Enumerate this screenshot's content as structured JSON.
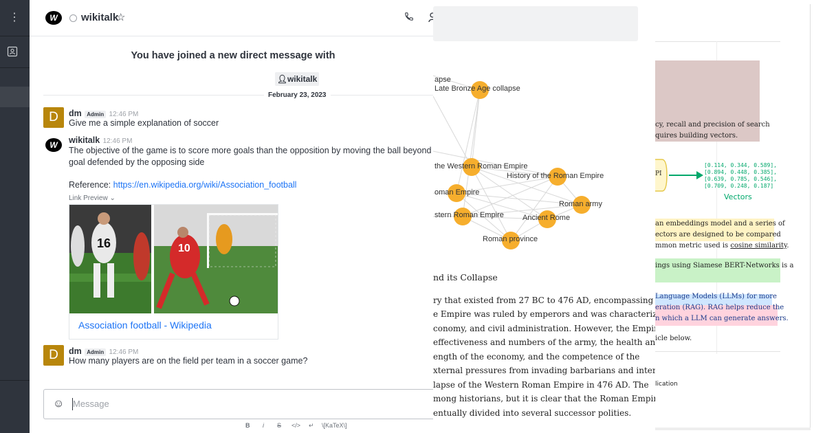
{
  "room": {
    "name": "wikitalk",
    "avatar_letter": "W"
  },
  "intro": {
    "joined_text": "You have joined a new direct message with",
    "mention": "wikitalk",
    "date": "February 23, 2023"
  },
  "messages": [
    {
      "avatar": "D",
      "user": "dm",
      "badge": "Admin",
      "time": "12:46 PM",
      "text": "Give me a simple explanation of soccer"
    },
    {
      "avatar": "W",
      "user": "wikitalk",
      "time": "12:46 PM",
      "text_line1": "The objective of the game is to score more goals than the opposition by moving the ball beyond the goa",
      "text_line2": "goal defended by the opposing side",
      "reference_label": "Reference:",
      "reference_url": "https://en.wikipedia.org/wiki/Association_football",
      "link_preview_label": "Link Preview",
      "preview_title": "Association football - Wikipedia"
    },
    {
      "avatar": "D",
      "user": "dm",
      "badge": "Admin",
      "time": "12:46 PM",
      "text": "How many players are on the field per team in a soccer game?"
    }
  ],
  "composer": {
    "placeholder": "Message",
    "toolbar": [
      "B",
      "i",
      "S",
      "</>",
      "↵",
      "\\[KaTeX\\]"
    ]
  },
  "graph": {
    "labels": {
      "l_apse": "apse",
      "bronze": "Late Bronze Age collapse",
      "western": "the Western Roman Empire",
      "history": "History of the Roman Empire",
      "roman_empire": "oman Empire",
      "roman_army": "Roman army",
      "stern": "stern Roman Empire",
      "ancient": "Ancient Rome",
      "province": "Roman province"
    },
    "heading": "nd its Collapse",
    "paragraph": [
      "ry that existed from 27 BC to 476 AD, encompassing",
      "e Empire was ruled by emperors and was characterized",
      "conomy, and civil administration. However, the Empire",
      "effectiveness and numbers of the army, the health and",
      "ength of the economy, and the competence of the",
      "xternal pressures from invading barbarians and internal",
      "lapse of the Western Roman Empire in 476 AD. The",
      "mong historians, but it is clear that the Roman Empire",
      "entually divided into several successor polities."
    ],
    "node_color": "#f6ae2d"
  },
  "document": {
    "lines_top": [
      "cy, recall and precision of search",
      "quires building vectors."
    ],
    "api_fragment": "PI",
    "vectors": [
      "[0.114, 0.344, 0.589],",
      "[0.894, 0.448, 0.385],",
      "[0.639, 0.785, 0.546],",
      "[0.709, 0.248, 0.187]"
    ],
    "vectors_label": "Vectors",
    "lines_mid": [
      "an embeddings model and a series of",
      "ectors are designed to be compared",
      "mmon metric used is",
      "cosine similarity",
      "."
    ],
    "bert_line": "ings using Siamese BERT-Networks is a",
    "llm_lines": [
      "Language Models (LLMs) for more",
      "eration (RAG). RAG helps reduce the",
      "n which a LLM can generate answers."
    ],
    "article_line": "icle below.",
    "bottom_line": "lication"
  }
}
